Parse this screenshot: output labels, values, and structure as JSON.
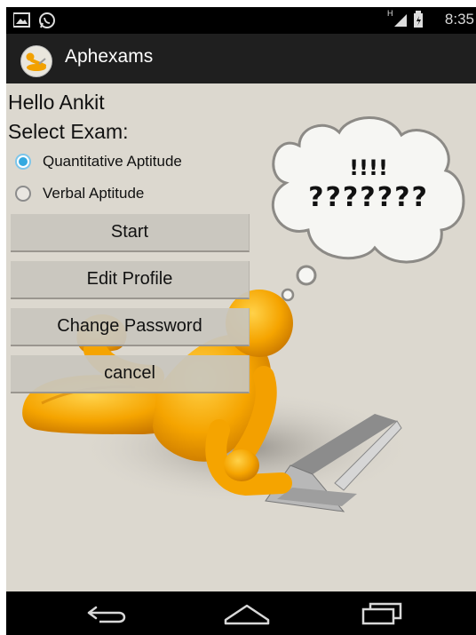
{
  "status_bar": {
    "time": "8:35",
    "network": "H"
  },
  "action_bar": {
    "app_icon": "app-logo-icon",
    "title": "Aphexams"
  },
  "main": {
    "greeting": "Hello Ankit",
    "select_prompt": "Select Exam:",
    "exam_options": [
      {
        "label": "Quantitative Aptitude",
        "checked": true
      },
      {
        "label": "Verbal Aptitude",
        "checked": false
      }
    ],
    "buttons": {
      "start": "Start",
      "edit_profile": "Edit Profile",
      "change_password": "Change Password",
      "cancel": "cancel"
    },
    "thought_bubble": {
      "line1": "!!!!",
      "line2": "???????"
    }
  },
  "nav_bar": {
    "back_icon": "back-icon",
    "home_icon": "home-icon",
    "recents_icon": "recents-icon"
  },
  "colors": {
    "accent": "#33a9e0",
    "background": "#dcd8cf",
    "figure": "#f2a100"
  }
}
